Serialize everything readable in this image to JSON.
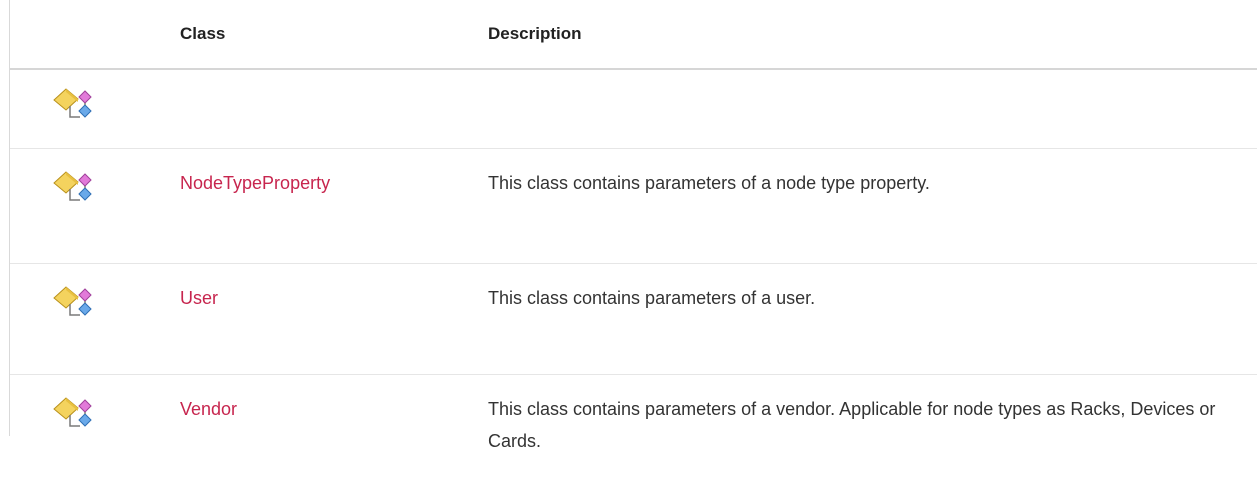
{
  "table": {
    "headers": {
      "icon": "",
      "class": "Class",
      "description": "Description"
    },
    "rows": [
      {
        "icon": "public-class-icon",
        "class": "",
        "description": ""
      },
      {
        "icon": "public-class-icon",
        "class": "NodeTypeProperty",
        "description": "This class contains parameters of a node type property."
      },
      {
        "icon": "public-class-icon",
        "class": "User",
        "description": "This class contains parameters of a user."
      },
      {
        "icon": "public-class-icon",
        "class": "Vendor",
        "description": "This class contains parameters of a vendor. Applicable for node types as Racks, Devices or Cards."
      }
    ]
  },
  "colors": {
    "link": "#c7254e",
    "text": "#333333",
    "header_rule": "#d6d6d6",
    "row_rule": "#e6e6e6"
  }
}
